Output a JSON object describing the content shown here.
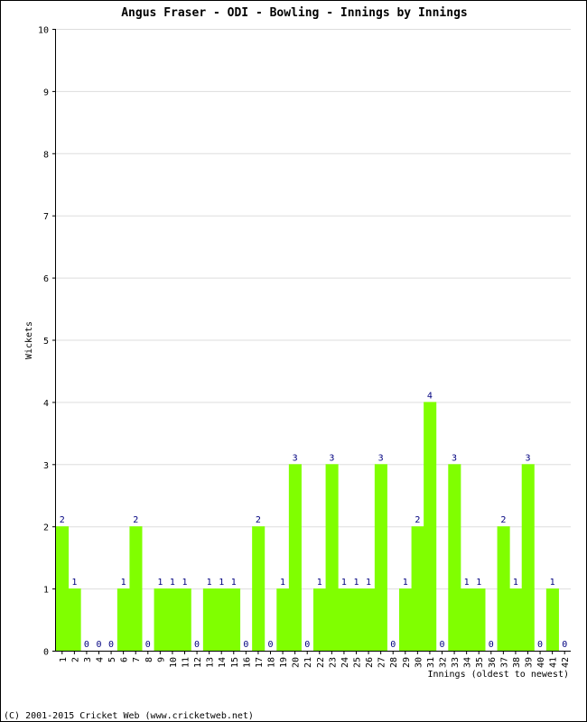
{
  "chart_data": {
    "type": "bar",
    "title": "Angus Fraser - ODI - Bowling - Innings by Innings",
    "xlabel": "Innings (oldest to newest)",
    "ylabel": "Wickets",
    "ylim": [
      0,
      10
    ],
    "yticks": [
      0,
      1,
      2,
      3,
      4,
      5,
      6,
      7,
      8,
      9,
      10
    ],
    "grid": true,
    "legend": "none",
    "bar_color": "#80ff00",
    "label_color": "#000080",
    "categories": [
      "1",
      "2",
      "3",
      "4",
      "5",
      "6",
      "7",
      "8",
      "9",
      "10",
      "11",
      "12",
      "13",
      "14",
      "15",
      "16",
      "17",
      "18",
      "19",
      "20",
      "21",
      "22",
      "23",
      "24",
      "25",
      "26",
      "27",
      "28",
      "29",
      "30",
      "31",
      "32",
      "33",
      "34",
      "35",
      "36",
      "37",
      "38",
      "39",
      "40",
      "41",
      "42"
    ],
    "values": [
      2,
      1,
      0,
      0,
      0,
      1,
      2,
      0,
      1,
      1,
      1,
      0,
      1,
      1,
      1,
      0,
      2,
      0,
      1,
      3,
      0,
      1,
      3,
      1,
      1,
      1,
      3,
      0,
      1,
      2,
      4,
      0,
      3,
      1,
      1,
      0,
      2,
      1,
      3,
      0,
      1,
      0
    ]
  },
  "footer": "(C) 2001-2015 Cricket Web (www.cricketweb.net)"
}
